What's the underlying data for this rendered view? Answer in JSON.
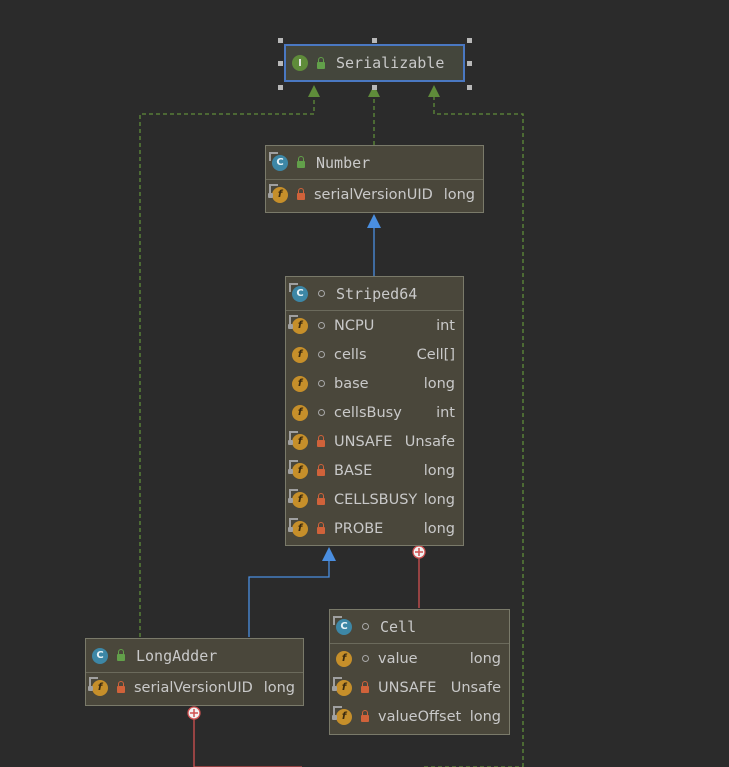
{
  "nodes": {
    "serializable": {
      "name": "Serializable",
      "kind": "I"
    },
    "number": {
      "name": "Number",
      "kind": "C",
      "fields": [
        {
          "name": "serialVersionUID",
          "type": "long"
        }
      ]
    },
    "striped64": {
      "name": "Striped64",
      "kind": "C",
      "fields": [
        {
          "name": "NCPU",
          "type": "int"
        },
        {
          "name": "cells",
          "type": "Cell[]"
        },
        {
          "name": "base",
          "type": "long"
        },
        {
          "name": "cellsBusy",
          "type": "int"
        },
        {
          "name": "UNSAFE",
          "type": "Unsafe"
        },
        {
          "name": "BASE",
          "type": "long"
        },
        {
          "name": "CELLSBUSY",
          "type": "long"
        },
        {
          "name": "PROBE",
          "type": "long"
        }
      ]
    },
    "longadder": {
      "name": "LongAdder",
      "kind": "C",
      "fields": [
        {
          "name": "serialVersionUID",
          "type": "long"
        }
      ]
    },
    "cell": {
      "name": "Cell",
      "kind": "C",
      "fields": [
        {
          "name": "value",
          "type": "long"
        },
        {
          "name": "UNSAFE",
          "type": "Unsafe"
        },
        {
          "name": "valueOffset",
          "type": "long"
        }
      ]
    }
  },
  "edges": [
    {
      "from": "number",
      "to": "serializable",
      "kind": "implements",
      "color": "#5f8c3a"
    },
    {
      "from": "longadder",
      "to": "serializable",
      "kind": "implements",
      "color": "#5f8c3a"
    },
    {
      "from": "striped64",
      "to": "number",
      "kind": "extends",
      "color": "#4a8ee0"
    },
    {
      "from": "longadder",
      "to": "striped64",
      "kind": "extends",
      "color": "#4a8ee0"
    },
    {
      "from": "cell",
      "to": "striped64",
      "kind": "inner",
      "color": "#d05050"
    }
  ]
}
